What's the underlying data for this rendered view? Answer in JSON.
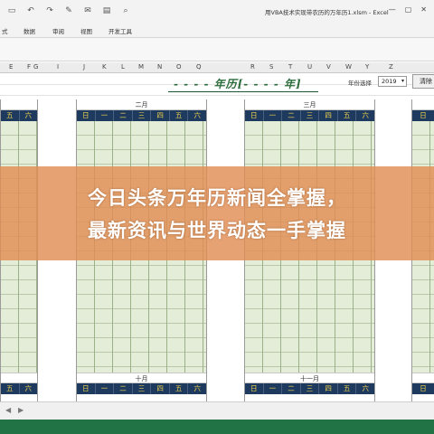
{
  "window": {
    "title": "用VBA技术实现带农历的万年历1.xlsm - Excel",
    "controls": [
      "—",
      "▢",
      "✕"
    ]
  },
  "quick_access": [
    "save-icon",
    "undo-icon",
    "redo-icon",
    "format-painter-icon",
    "email-icon",
    "document-icon",
    "print-preview-icon"
  ],
  "ribbon": {
    "tabs": [
      "式",
      "数据",
      "审阅",
      "视图",
      "开发工具"
    ]
  },
  "columns": [
    "E",
    "F",
    "G",
    "I",
    "J",
    "K",
    "L",
    "M",
    "N",
    "O",
    "Q",
    "R",
    "S",
    "T",
    "U",
    "V",
    "W",
    "Y",
    "Z"
  ],
  "sheet": {
    "heading": "- - - -  年历[- - - - 年]",
    "year_label": "年份选择",
    "year_value": "2019",
    "clear_button": "清除"
  },
  "weekdays_full": [
    "日",
    "一",
    "二",
    "三",
    "四",
    "五",
    "六"
  ],
  "weekdays_left_partial": [
    "五",
    "六"
  ],
  "weekdays_right_partial": [
    "日"
  ],
  "months": {
    "feb": "二月",
    "mar": "三月",
    "oct": "十月",
    "nov": "十一月"
  },
  "banner": {
    "line1": "今日头条万年历新闻全掌握，",
    "line2": "最新资讯与世界动态一手掌握"
  },
  "colors": {
    "excel_green": "#217346",
    "day_header_bg": "#1f3a5f",
    "day_header_text": "#f3d64a",
    "calendar_cell_bg": "#e3edd8",
    "banner_orange": "#e28e54",
    "heading_green": "#2a6b3a"
  }
}
